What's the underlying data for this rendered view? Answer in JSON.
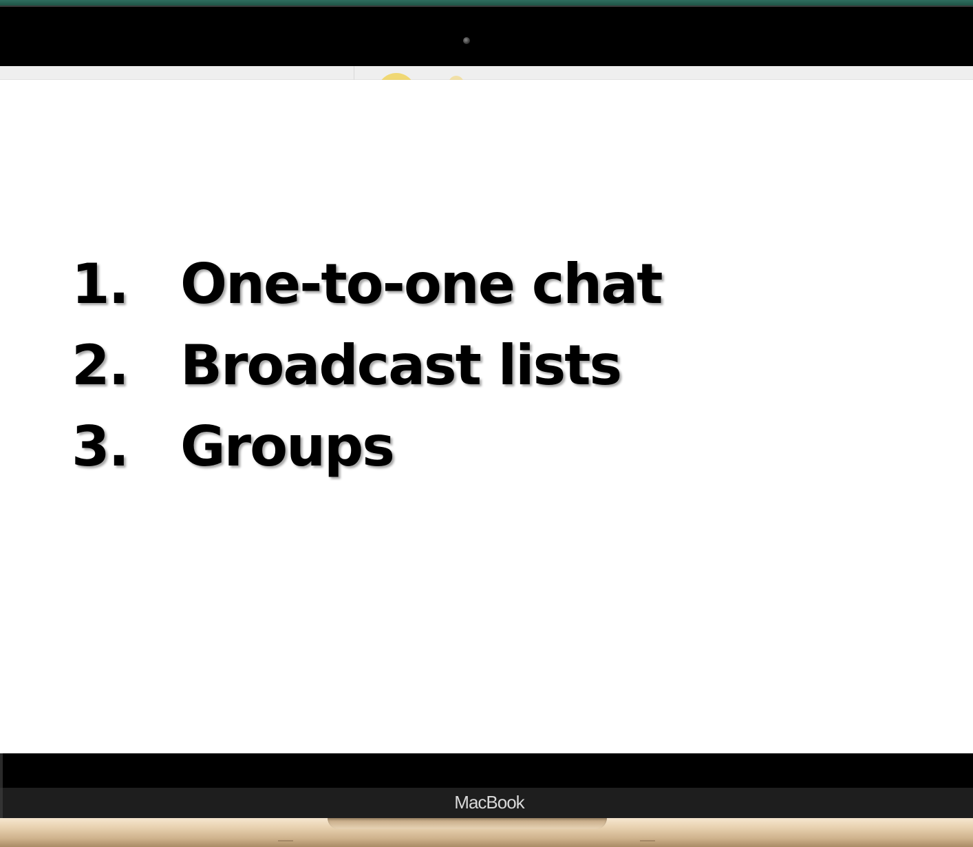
{
  "slide": {
    "items": [
      {
        "number": "1.",
        "text": "One-to-one chat"
      },
      {
        "number": "2.",
        "text": "Broadcast lists"
      },
      {
        "number": "3.",
        "text": "Groups"
      }
    ]
  },
  "device": {
    "brand_label": "MacBook"
  },
  "colors": {
    "text": "#000000",
    "background": "#ffffff",
    "bezel": "#000000",
    "base": "#e9d3b2",
    "top_edge": "#2f6d5e"
  }
}
